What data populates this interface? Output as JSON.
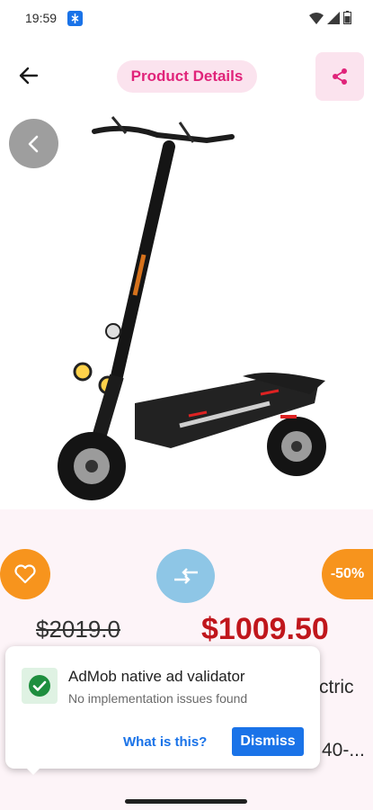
{
  "status_bar": {
    "time": "19:59"
  },
  "header": {
    "title": "Product Details"
  },
  "icons": {
    "back": "arrow-left-icon",
    "share": "share-icon",
    "gallery_back": "chevron-left-icon",
    "favorite": "heart-icon",
    "compare": "compare-arrows-icon",
    "check": "check-circle-icon"
  },
  "product": {
    "old_price": "$2019.0",
    "new_price": "$1009.50",
    "discount": "-50%",
    "name_fragment_1": "ctric",
    "name_fragment_2": "40-..."
  },
  "admob": {
    "title": "AdMob native ad validator",
    "subtitle": "No implementation issues found",
    "link_label": "What is this?",
    "dismiss_label": "Dismiss"
  },
  "colors": {
    "accent_pink": "#e0247a",
    "pink_bg": "#fbe3ee",
    "orange": "#f7941d",
    "price_red": "#c0161c",
    "compare_blue": "#8ec6e6",
    "link_blue": "#1a73e8"
  }
}
